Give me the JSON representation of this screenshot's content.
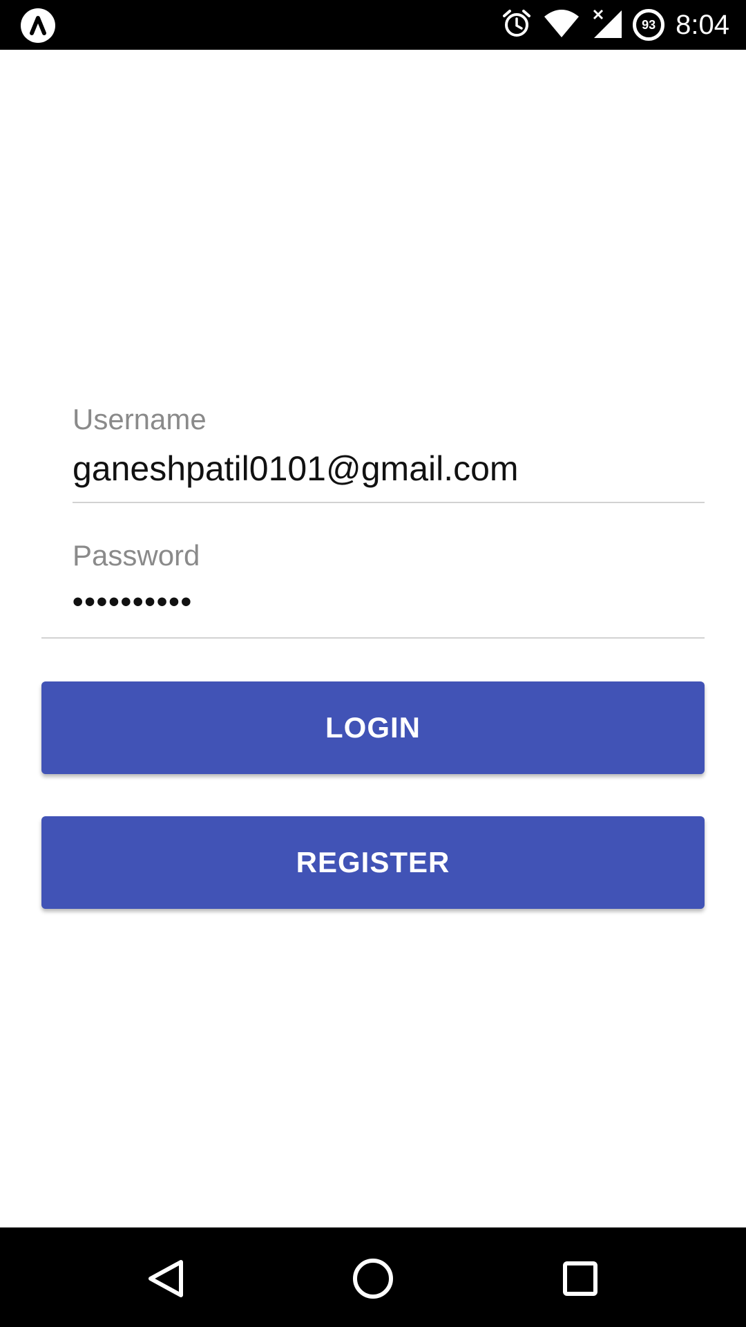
{
  "status_bar": {
    "time": "8:04",
    "battery_level": "93",
    "icons": [
      "app-logo-icon",
      "alarm-icon",
      "wifi-icon",
      "signal-no-data-icon",
      "battery-icon"
    ]
  },
  "login_form": {
    "username_label": "Username",
    "username_value": "ganeshpatil0101@gmail.com",
    "password_label": "Password",
    "password_value": "••••••••••",
    "login_label": "LOGIN",
    "register_label": "REGISTER"
  },
  "colors": {
    "primary": "#4153b6",
    "status_bar": "#000000",
    "label_gray": "#8a8a8a"
  },
  "nav_bar": {
    "icons": [
      "back-icon",
      "home-icon",
      "recents-icon"
    ]
  }
}
